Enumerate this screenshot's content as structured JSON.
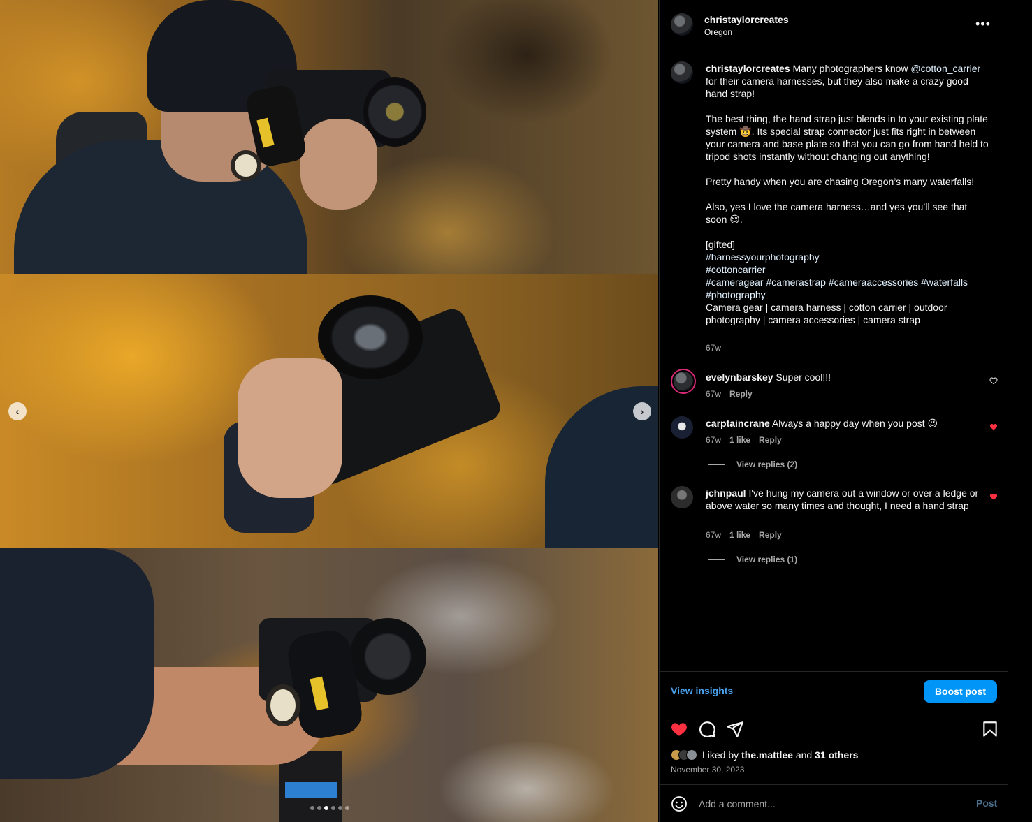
{
  "post": {
    "username": "christaylorcreates",
    "location": "Oregon",
    "more_label": "•••",
    "caption_lines": [
      "Many photographers know",
      "@cotton_carrier",
      "for their camera harnesses, but they also make a crazy good hand strap!"
    ],
    "caption_p1_rest": " for their camera harnesses, but they also make a crazy good hand strap!",
    "caption_mention": "@cotton_carrier",
    "caption_intro": " Many photographers know ",
    "caption_p2": "The best thing, the hand strap just blends in to your existing plate system 🤠. Its special strap connector just fits right in between your camera and base plate so that you can go from hand held to tripod shots instantly without changing out anything!",
    "caption_p3": "Pretty handy when you are chasing Oregon’s many waterfalls!",
    "caption_p4": "Also, yes I love the camera harness…and yes you’ll see that soon 😌.",
    "caption_gifted": "[gifted]",
    "caption_tag1": "#harnessyourphotography",
    "caption_tag2": "#cottoncarrier",
    "caption_tags3": "#cameragear #camerastrap #cameraaccessories #waterfalls #photography",
    "caption_keywords": "Camera gear | camera harness | cotton carrier | outdoor photography | camera accessories | camera strap",
    "caption_time": "67w"
  },
  "comments": [
    {
      "username": "evelynbarskey",
      "text": "Super cool!!!",
      "time": "67w",
      "likes": "",
      "reply": "Reply",
      "liked": false
    },
    {
      "username": "carptaincrane",
      "text": "Always a happy day when you post 😉",
      "time": "67w",
      "likes": "1 like",
      "reply": "Reply",
      "liked": true,
      "view_replies": "View replies (2)"
    },
    {
      "username": "jchnpaul",
      "text": "I've hung my camera out a window or over a ledge or above water so many times and thought, I need a hand strap",
      "time": "67w",
      "likes": "1 like",
      "reply": "Reply",
      "liked": true,
      "view_replies": "View replies (1)"
    }
  ],
  "insights": {
    "view_label": "View insights",
    "boost_label": "Boost post"
  },
  "likes": {
    "prefix": "Liked by ",
    "user": "the.mattlee",
    "middle": " and ",
    "others": "31 others"
  },
  "date": "November 30, 2023",
  "comment_input": {
    "placeholder": "Add a comment...",
    "post_label": "Post"
  },
  "carousel": {
    "slides": 6,
    "active_index": 2
  },
  "colors": {
    "accent_blue": "#0095f6",
    "link_blue": "#4aa3f0",
    "like_red": "#ff3040",
    "background": "#000000",
    "muted": "#a8a8a8"
  },
  "icons": [
    "more-icon",
    "heart-icon",
    "comment-icon",
    "share-icon",
    "bookmark-icon",
    "emoji-icon",
    "chevron-left-icon",
    "chevron-right-icon"
  ]
}
